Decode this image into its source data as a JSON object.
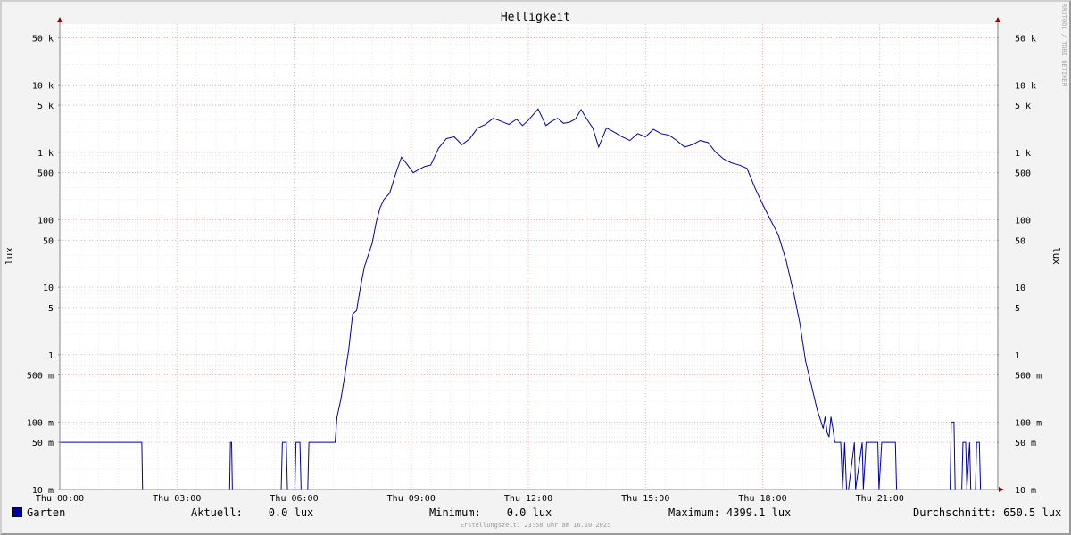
{
  "watermark": "RRDTOOL / TOBI OETIKER",
  "chart_data": {
    "type": "line",
    "title": "Helligkeit",
    "ylabel": "lux",
    "y_scale": "log",
    "ylim": [
      0.01,
      80000
    ],
    "y_ticks": [
      {
        "value": 50000,
        "label": "50 k"
      },
      {
        "value": 10000,
        "label": "10 k"
      },
      {
        "value": 5000,
        "label": "5 k"
      },
      {
        "value": 1000,
        "label": "1 k"
      },
      {
        "value": 500,
        "label": "500"
      },
      {
        "value": 100,
        "label": "100"
      },
      {
        "value": 50,
        "label": "50"
      },
      {
        "value": 10,
        "label": "10"
      },
      {
        "value": 5,
        "label": "5"
      },
      {
        "value": 1,
        "label": "1"
      },
      {
        "value": 0.5,
        "label": "500 m"
      },
      {
        "value": 0.1,
        "label": "100 m"
      },
      {
        "value": 0.05,
        "label": "50 m"
      },
      {
        "value": 0.01,
        "label": "10 m"
      }
    ],
    "xlim": [
      0,
      24
    ],
    "x_ticks": [
      {
        "value": 0,
        "label": "Thu 00:00"
      },
      {
        "value": 3,
        "label": "Thu 03:00"
      },
      {
        "value": 6,
        "label": "Thu 06:00"
      },
      {
        "value": 9,
        "label": "Thu 09:00"
      },
      {
        "value": 12,
        "label": "Thu 12:00"
      },
      {
        "value": 15,
        "label": "Thu 15:00"
      },
      {
        "value": 18,
        "label": "Thu 18:00"
      },
      {
        "value": 21,
        "label": "Thu 21:00"
      }
    ],
    "grid": true,
    "series": [
      {
        "name": "Garten",
        "color": "#0000aa",
        "x": [
          0,
          2.1,
          2.12,
          4.35,
          4.37,
          4.4,
          4.42,
          5.67,
          5.7,
          5.8,
          5.83,
          6.02,
          6.05,
          6.15,
          6.18,
          6.35,
          6.38,
          7.05,
          7.1,
          7.2,
          7.3,
          7.4,
          7.5,
          7.6,
          7.7,
          7.8,
          7.9,
          8.0,
          8.1,
          8.2,
          8.3,
          8.45,
          8.6,
          8.75,
          8.9,
          9.05,
          9.2,
          9.35,
          9.5,
          9.7,
          9.9,
          10.1,
          10.3,
          10.5,
          10.7,
          10.9,
          11.1,
          11.3,
          11.5,
          11.7,
          11.85,
          12.0,
          12.25,
          12.45,
          12.6,
          12.75,
          12.9,
          13.05,
          13.2,
          13.35,
          13.5,
          13.65,
          13.8,
          14.0,
          14.2,
          14.4,
          14.6,
          14.8,
          15.0,
          15.2,
          15.4,
          15.6,
          15.8,
          16.0,
          16.2,
          16.4,
          16.6,
          16.8,
          17.0,
          17.2,
          17.4,
          17.6,
          17.8,
          18.0,
          18.2,
          18.4,
          18.6,
          18.8,
          18.95,
          19.1,
          19.25,
          19.4,
          19.5,
          19.55,
          19.6,
          19.65,
          19.7,
          19.75,
          19.8,
          19.85,
          19.9,
          19.95,
          20.0,
          20.05,
          20.1,
          20.15,
          20.2,
          20.35,
          20.38,
          20.55,
          20.58,
          20.65,
          20.68,
          20.95,
          20.98,
          21.05,
          21.08,
          21.4,
          21.43,
          22.15,
          22.18,
          22.8,
          22.83,
          22.9,
          22.93,
          23.1,
          23.13,
          23.2,
          23.23,
          23.3,
          23.33,
          23.45,
          23.48,
          23.55,
          23.58,
          24.0
        ],
        "y": [
          0.05,
          0.05,
          0.01,
          0.01,
          0.05,
          0.05,
          0.01,
          0.01,
          0.05,
          0.05,
          0.01,
          0.01,
          0.05,
          0.05,
          0.01,
          0.01,
          0.05,
          0.05,
          0.12,
          0.22,
          0.5,
          1.2,
          4,
          4.5,
          10,
          20,
          30,
          45,
          90,
          150,
          200,
          250,
          480,
          850,
          660,
          500,
          560,
          620,
          650,
          1150,
          1600,
          1700,
          1300,
          1600,
          2300,
          2600,
          3200,
          2900,
          2600,
          3100,
          2500,
          3000,
          4400,
          2500,
          2900,
          3200,
          2700,
          2800,
          3100,
          4300,
          3100,
          2300,
          1200,
          2300,
          2000,
          1700,
          1500,
          1900,
          1700,
          2200,
          1900,
          1800,
          1500,
          1200,
          1300,
          1500,
          1400,
          1000,
          800,
          700,
          650,
          580,
          300,
          170,
          100,
          60,
          25,
          8,
          3,
          0.8,
          0.35,
          0.15,
          0.1,
          0.08,
          0.12,
          0.07,
          0.06,
          0.12,
          0.08,
          0.05,
          0.05,
          0.05,
          0.05,
          0.01,
          0.05,
          0.01,
          0.01,
          0.05,
          0.01,
          0.05,
          0.01,
          0.05,
          0.05,
          0.05,
          0.01,
          0.05,
          0.05,
          0.05,
          0.01,
          0.01,
          0.01,
          0.01,
          0.1,
          0.1,
          0.01,
          0.01,
          0.05,
          0.05,
          0.01,
          0.05,
          0.01,
          0.01,
          0.05,
          0.05,
          0.01,
          0.01
        ]
      }
    ]
  },
  "legend": {
    "series_name": "Garten",
    "aktuell": "Aktuell:    0.0 lux",
    "minimum": "Minimum:    0.0 lux",
    "maximum": "Maximum: 4399.1 lux",
    "durchschnitt": "Durchschnitt: 650.5 lux"
  },
  "footer": "Erstellungszeit: 23:58 Uhr am 16.10.2025"
}
